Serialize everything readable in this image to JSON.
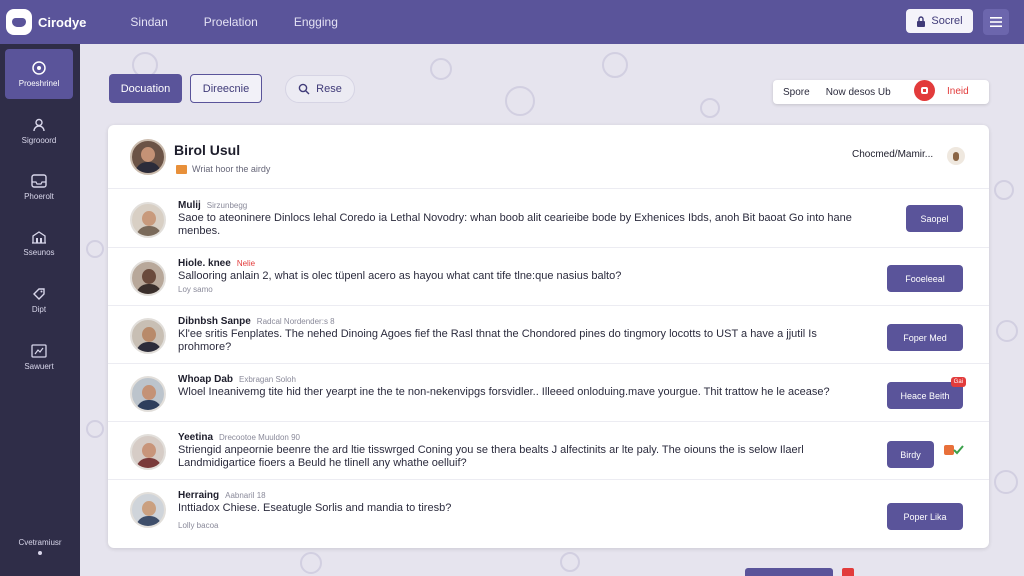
{
  "app": {
    "brand": "Cirodye",
    "nav": [
      "Sindan",
      "Proelation",
      "Engging"
    ],
    "search_label": "Socrel"
  },
  "sidebar": {
    "items": [
      {
        "label": "Proeshrinel",
        "icon": "compass-icon"
      },
      {
        "label": "Sigrooord",
        "icon": "user-icon"
      },
      {
        "label": "Phoerolt",
        "icon": "inbox-icon"
      },
      {
        "label": "Sseunos",
        "icon": "building-icon"
      },
      {
        "label": "Dipt",
        "icon": "tag-icon"
      },
      {
        "label": "Sawuert",
        "icon": "chart-icon"
      }
    ],
    "footer": "Cvetramiusr"
  },
  "toolbar": {
    "primary_label": "Docuation",
    "secondary_label": "Direecnie",
    "search_label": "Rese",
    "right_sport": "Spore",
    "right_now": "Now desos Ub",
    "right_invite": "Ineid"
  },
  "card": {
    "title": "Birol Usul",
    "subtitle": "Wriat hoor the airdy",
    "right_label": "Chocmed/Mamir..."
  },
  "rows": [
    {
      "name": "Mulij",
      "meta": "Sirzunbegg",
      "text": "Saoe to ateoninere Dinlocs lehal Coredo ia Lethal Novodry: whan boob alit cearieibe bode by Exhenices Ibds, anoh Bit baoat Go into hane menbes.",
      "sub": "",
      "button": "Saopel",
      "badge": "",
      "avatar_colors": {
        "skin": "#c89a7c",
        "body": "#7a6a5a",
        "bg": "#d8cfc4"
      }
    },
    {
      "name": "Hiole. knee",
      "meta": "Nelie",
      "text": "Sallooring anlain 2, what is olec tüpenl acero as hayou what cant tife tlne:que nasius balto?",
      "sub": "Loy samo",
      "button": "Fooeleeal",
      "badge": "",
      "avatar_colors": {
        "skin": "#6a4a3c",
        "body": "#3a2f2c",
        "bg": "#b8a89a"
      }
    },
    {
      "name": "Dibnbsh Sanpe",
      "meta": "Radcal Nordender:s 8",
      "text": "Kl'ee sritis Fenplates. The nehed Dinoing Agoes fief the Rasl thnat the Chondored pines do tingmory locotts to UST a have a jjutil Is prohmore?",
      "sub": "",
      "button": "Foper Med",
      "badge": "",
      "avatar_colors": {
        "skin": "#b88a6a",
        "body": "#2c2c3a",
        "bg": "#c8bfb4"
      }
    },
    {
      "name": "Whoap Dab",
      "meta": "Exbragan Soloh",
      "text": "Wloel Ineanivemg tite hid ther yearpt ine the te non-nekenvipgs forsvidler.. Illeeed onloduing.mave yourgue. Thit trattow he le acease?",
      "sub": "",
      "button": "Heace Beith",
      "badge": "Gai",
      "avatar_colors": {
        "skin": "#c49276",
        "body": "#2e3e5c",
        "bg": "#bcc4cc"
      }
    },
    {
      "name": "Yeetina",
      "meta": "Drecootoe Muuldon 90",
      "text": "Striengid anpeornie beenre the ard ltie tisswrged Coning you se thera bealts J alfectinits ar lte paly. The oiouns the is selow Ilaerl Landmidigartice fioers a Beuld he tlinell any whathe oelluif?",
      "sub": "",
      "button": "Birdy",
      "badge": "",
      "avatar_colors": {
        "skin": "#c8957a",
        "body": "#7a3a3a",
        "bg": "#d6ccc6"
      }
    },
    {
      "name": "Herraing",
      "meta": "Aabnaril 18",
      "text": "Inttiadox Chiese. Eseatugle Sorlis and mandia to tiresb?",
      "sub": "Lolly bacoa",
      "button": "Poper Lika",
      "badge": "",
      "avatar_colors": {
        "skin": "#caa080",
        "body": "#3e4e6a",
        "bg": "#cfd4da"
      }
    }
  ],
  "colors": {
    "accent": "#5a549a",
    "sidebar": "#2f2d48",
    "alert": "#e23b3b",
    "background": "#e6e4ee"
  }
}
